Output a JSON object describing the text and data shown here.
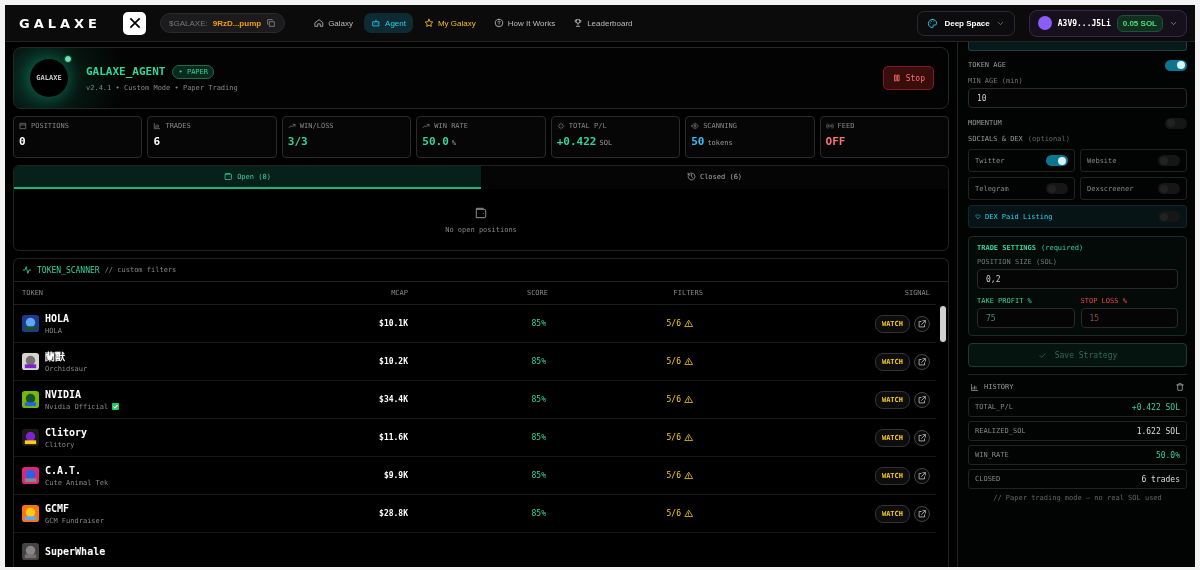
{
  "header": {
    "logo": "GALAXE",
    "token_label": "$GALAXE:",
    "token_address": "9RzD...pump",
    "nav": [
      {
        "label": "Galaxy",
        "selected": false,
        "kind": "normal"
      },
      {
        "label": "Agent",
        "selected": true,
        "kind": "normal"
      },
      {
        "label": "My Galaxy",
        "selected": false,
        "kind": "featured"
      },
      {
        "label": "How It Works",
        "selected": false,
        "kind": "normal"
      },
      {
        "label": "Leaderboard",
        "selected": false,
        "kind": "normal"
      }
    ],
    "theme": "Deep Space",
    "wallet_address": "A3V9...J5Li",
    "wallet_balance": "0.05 SOL"
  },
  "agent": {
    "logo_text": "GALAXE",
    "online": true,
    "name": "GALAXE_AGENT",
    "badge": "• PAPER",
    "subtitle": "v2.4.1 • Custom Mode • Paper Trading",
    "stop_label": "Stop"
  },
  "stats": [
    {
      "label": "POSITIONS",
      "value": "0",
      "color": "#ffffff"
    },
    {
      "label": "TRADES",
      "value": "6",
      "color": "#ffffff"
    },
    {
      "label": "WIN/LOSS",
      "value": "3/3",
      "color": "#34d399"
    },
    {
      "label": "WIN RATE",
      "value": "50.0",
      "unit": "%",
      "color": "#34d399"
    },
    {
      "label": "TOTAL P/L",
      "value": "+0.422",
      "unit": "SOL",
      "color": "#34d399"
    },
    {
      "label": "SCANNING",
      "value": "50",
      "unit": "tokens",
      "color": "#38bdf8"
    },
    {
      "label": "FEED",
      "value": "OFF",
      "color": "#f87171"
    }
  ],
  "positions": {
    "tabs": [
      {
        "label": "Open (0)",
        "selected": true
      },
      {
        "label": "Closed (6)",
        "selected": false
      }
    ],
    "empty_text": "No open positions"
  },
  "scanner": {
    "title": "TOKEN_SCANNER",
    "subtitle": "// custom filters",
    "columns": [
      "TOKEN",
      "MCAP",
      "SCORE",
      "FILTERS",
      "SIGNAL"
    ],
    "rows": [
      {
        "name": "HOLA",
        "symbol": "HOLA",
        "verified": false,
        "mcap": "$10.1K",
        "score": "85%",
        "filters": "5/6",
        "signal": "WATCH"
      },
      {
        "name": "蘭獸",
        "symbol": "Orchidsaur",
        "verified": false,
        "mcap": "$10.2K",
        "score": "85%",
        "filters": "5/6",
        "signal": "WATCH"
      },
      {
        "name": "NVIDIA",
        "symbol": "Nvidia Official",
        "verified": true,
        "mcap": "$34.4K",
        "score": "85%",
        "filters": "5/6",
        "signal": "WATCH"
      },
      {
        "name": "Clitory",
        "symbol": "Clitory",
        "verified": false,
        "mcap": "$11.6K",
        "score": "85%",
        "filters": "5/6",
        "signal": "WATCH"
      },
      {
        "name": "C.A.T.",
        "symbol": "Cute Animal Tek",
        "verified": false,
        "mcap": "$9.9K",
        "score": "85%",
        "filters": "5/6",
        "signal": "WATCH"
      },
      {
        "name": "GCMF",
        "symbol": "GCM Fundraiser",
        "verified": false,
        "mcap": "$28.8K",
        "score": "85%",
        "filters": "5/6",
        "signal": "WATCH"
      },
      {
        "name": "SuperWhale"
      }
    ]
  },
  "sidebar": {
    "token_age": {
      "label": "TOKEN AGE",
      "on": true
    },
    "min_age": {
      "label": "MIN AGE (min)",
      "value": "10"
    },
    "momentum": {
      "label": "MOMENTUM",
      "on": false
    },
    "socials": {
      "title": "SOCIALS & DEX",
      "hint": "(optional)",
      "items": [
        {
          "label": "Twitter",
          "on": true
        },
        {
          "label": "Website",
          "on": false
        },
        {
          "label": "Telegram",
          "on": false
        },
        {
          "label": "Dexscreener",
          "on": false
        }
      ]
    },
    "dex_paid": {
      "label": "DEX Paid Listing",
      "on": false
    },
    "trade": {
      "title": "TRADE SETTINGS",
      "hint": "(required)",
      "position_label": "POSITION SIZE (SOL)",
      "position_value": "0,2",
      "tp_label": "TAKE PROFIT %",
      "tp_value": "75",
      "sl_label": "STOP LOSS %",
      "sl_value": "15"
    },
    "save_label": "Save Strategy",
    "history": {
      "title": "HISTORY",
      "rows": [
        {
          "label": "TOTAL_P/L",
          "value": "+0.422 SOL",
          "positive": true
        },
        {
          "label": "REALIZED_SOL",
          "value": "1.622 SOL",
          "positive": false
        },
        {
          "label": "WIN_RATE",
          "value": "50.0%",
          "positive": true
        },
        {
          "label": "CLOSED",
          "value": "6 trades",
          "positive": false
        }
      ]
    },
    "footer": "// Paper trading mode — no real SOL used"
  }
}
